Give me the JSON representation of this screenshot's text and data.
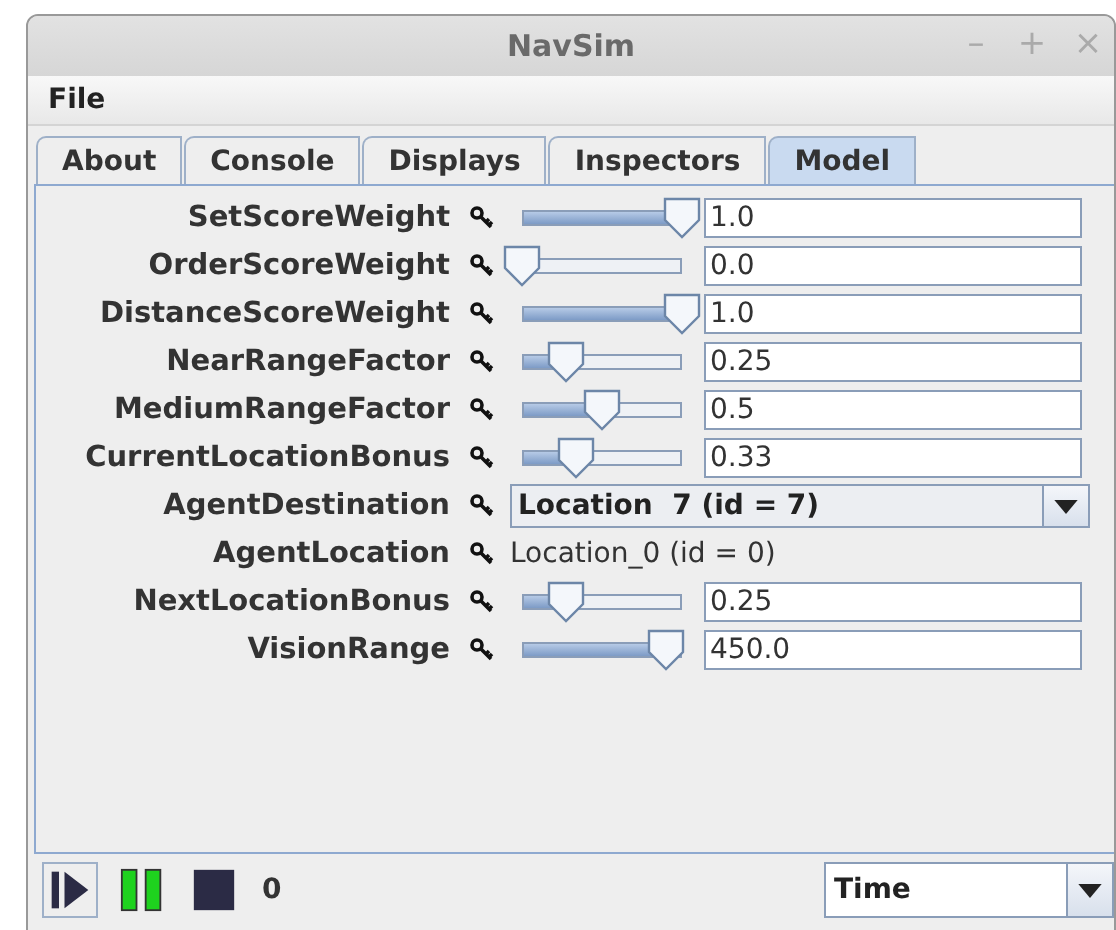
{
  "window": {
    "title": "NavSim",
    "controls": [
      "–",
      "+",
      "×"
    ]
  },
  "menu": [
    "File"
  ],
  "tabs": [
    {
      "label": "About",
      "selected": false
    },
    {
      "label": "Console",
      "selected": false
    },
    {
      "label": "Displays",
      "selected": false
    },
    {
      "label": "Inspectors",
      "selected": false
    },
    {
      "label": "Model",
      "selected": true
    }
  ],
  "properties": [
    {
      "kind": "slider",
      "name": "SetScoreWeight",
      "level": 1.0,
      "value": "1.0"
    },
    {
      "kind": "slider",
      "name": "OrderScoreWeight",
      "level": 0.0,
      "value": "0.0"
    },
    {
      "kind": "slider",
      "name": "DistanceScoreWeight",
      "level": 1.0,
      "value": "1.0"
    },
    {
      "kind": "slider",
      "name": "NearRangeFactor",
      "level": 0.27,
      "value": "0.25"
    },
    {
      "kind": "slider",
      "name": "MediumRangeFactor",
      "level": 0.5,
      "value": "0.5"
    },
    {
      "kind": "slider",
      "name": "CurrentLocationBonus",
      "level": 0.34,
      "value": "0.33"
    },
    {
      "kind": "dropdown",
      "name": "AgentDestination",
      "value": "Location  7 (id = 7)"
    },
    {
      "kind": "readonly",
      "name": "AgentLocation",
      "value": "Location_0 (id = 0)"
    },
    {
      "kind": "slider",
      "name": "NextLocationBonus",
      "level": 0.27,
      "value": "0.25"
    },
    {
      "kind": "slider",
      "name": "VisionRange",
      "level": 0.9,
      "value": "450.0"
    }
  ],
  "status_bar": {
    "step_count": "0",
    "time_mode": "Time"
  }
}
